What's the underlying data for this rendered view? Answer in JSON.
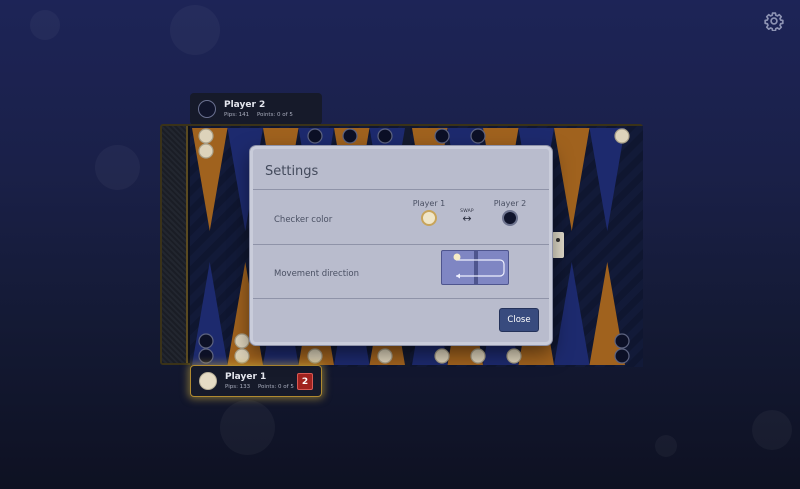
{
  "players": {
    "top": {
      "name": "Player 2",
      "pips_label": "Pips: 141",
      "points_label": "Points: 0 of 5"
    },
    "bottom": {
      "name": "Player 1",
      "pips_label": "Pips: 133",
      "points_label": "Points: 0 of 5",
      "dice_value": "2"
    }
  },
  "settings": {
    "title": "Settings",
    "checker_color": {
      "label": "Checker color",
      "option_1": "Player 1",
      "option_2": "Player 2",
      "swap_label": "SWAP",
      "swap_icon": "↔"
    },
    "movement_direction": {
      "label": "Movement direction"
    },
    "close_label": "Close"
  },
  "colors": {
    "point_orange": "#a0621e",
    "point_blue": "#1d2a6e",
    "board_felt": "#0f1630",
    "close_button": "#384b7e",
    "dice_badge": "#a1231f"
  }
}
